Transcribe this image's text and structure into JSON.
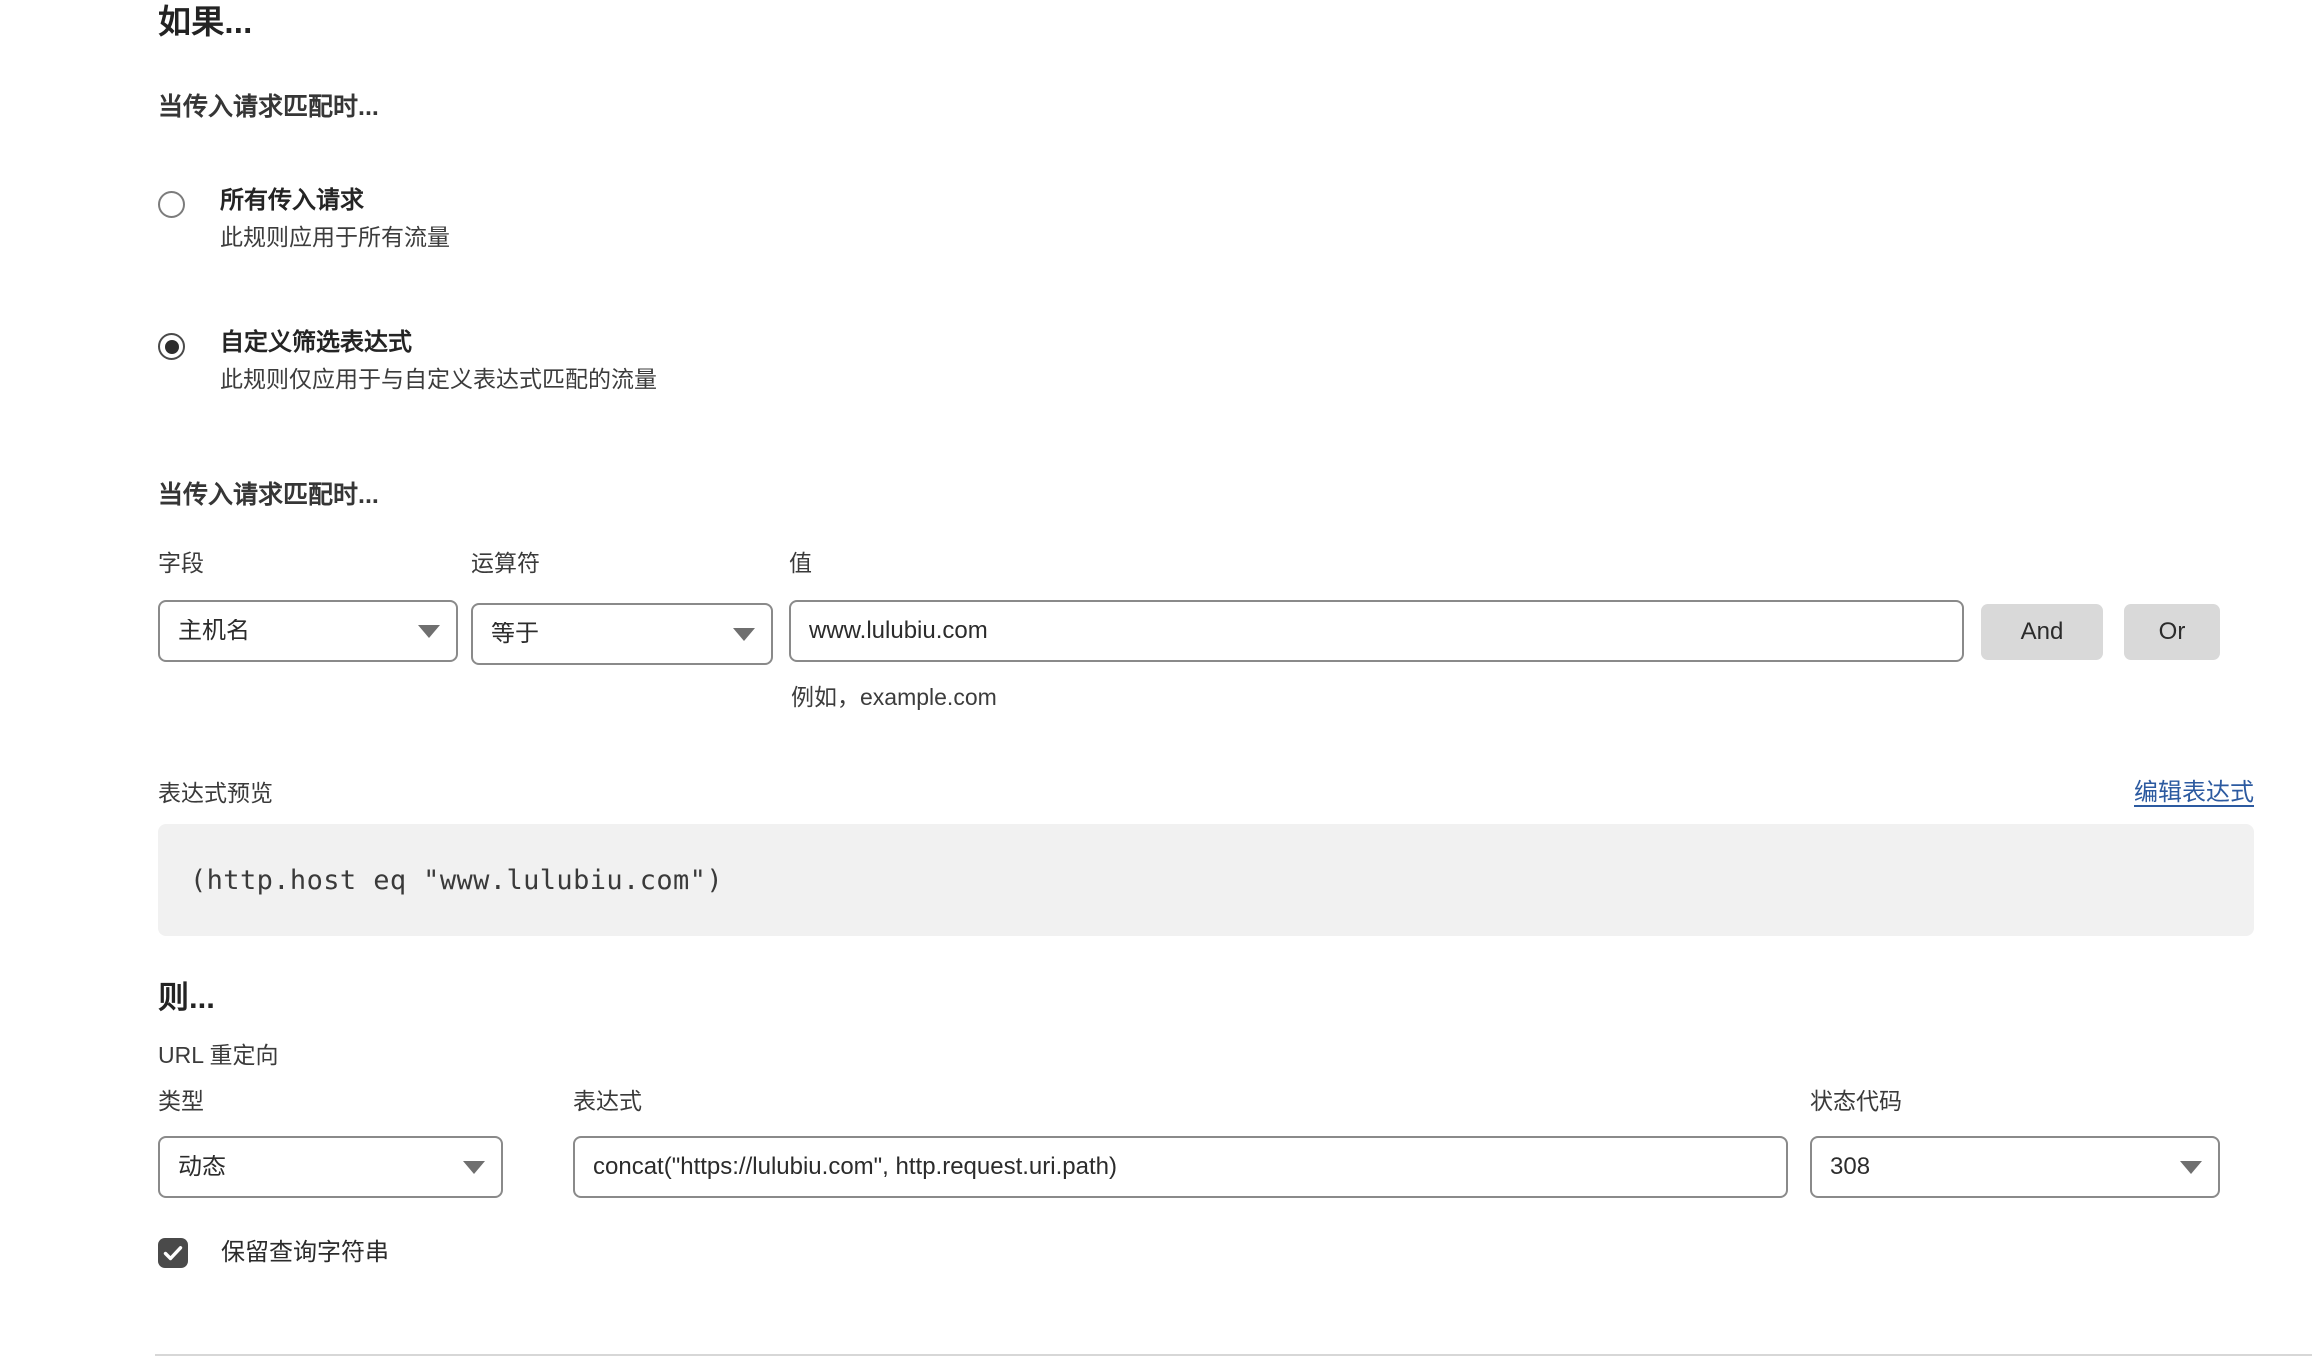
{
  "section_if": {
    "title": "如果...",
    "subtitle": "当传入请求匹配时...",
    "options": [
      {
        "label": "所有传入请求",
        "description": "此规则应用于所有流量",
        "selected": false
      },
      {
        "label": "自定义筛选表达式",
        "description": "此规则仅应用于与自定义表达式匹配的流量",
        "selected": true
      }
    ]
  },
  "matcher": {
    "heading": "当传入请求匹配时...",
    "field": {
      "label": "字段",
      "value": "主机名"
    },
    "operator": {
      "label": "运算符",
      "value": "等于"
    },
    "value": {
      "label": "值",
      "value": "www.lulubiu.com",
      "helper": "例如，example.com"
    },
    "and_label": "And",
    "or_label": "Or"
  },
  "preview": {
    "label": "表达式预览",
    "edit_link": "编辑表达式",
    "expression": "(http.host eq \"www.lulubiu.com\")"
  },
  "section_then": {
    "title": "则...",
    "action": "URL 重定向",
    "type": {
      "label": "类型",
      "value": "动态"
    },
    "expression": {
      "label": "表达式",
      "value": "concat(\"https://lulubiu.com\", http.request.uri.path)"
    },
    "status_code": {
      "label": "状态代码",
      "value": "308"
    },
    "preserve_query": {
      "label": "保留查询字符串",
      "checked": true
    }
  },
  "colors": {
    "link": "#2c5aa0",
    "chip_bg": "#d9d9d9",
    "preview_bg": "#f1f1f1",
    "border": "#8a8a8a",
    "checkbox_fill": "#4a4a4a"
  }
}
